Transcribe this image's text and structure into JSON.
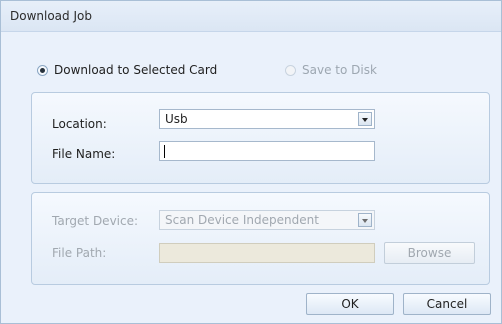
{
  "window": {
    "title": "Download Job"
  },
  "mode": {
    "download_label": "Download to Selected Card",
    "download_selected": true,
    "save_label": "Save to Disk",
    "save_enabled": false
  },
  "card_group": {
    "location_label": "Location:",
    "location_value": "Usb",
    "filename_label": "File Name:",
    "filename_value": ""
  },
  "disk_group": {
    "target_label": "Target Device:",
    "target_value": "Scan Device Independent",
    "filepath_label": "File Path:",
    "filepath_value": "",
    "browse_label": "Browse"
  },
  "footer": {
    "ok_label": "OK",
    "cancel_label": "Cancel"
  }
}
